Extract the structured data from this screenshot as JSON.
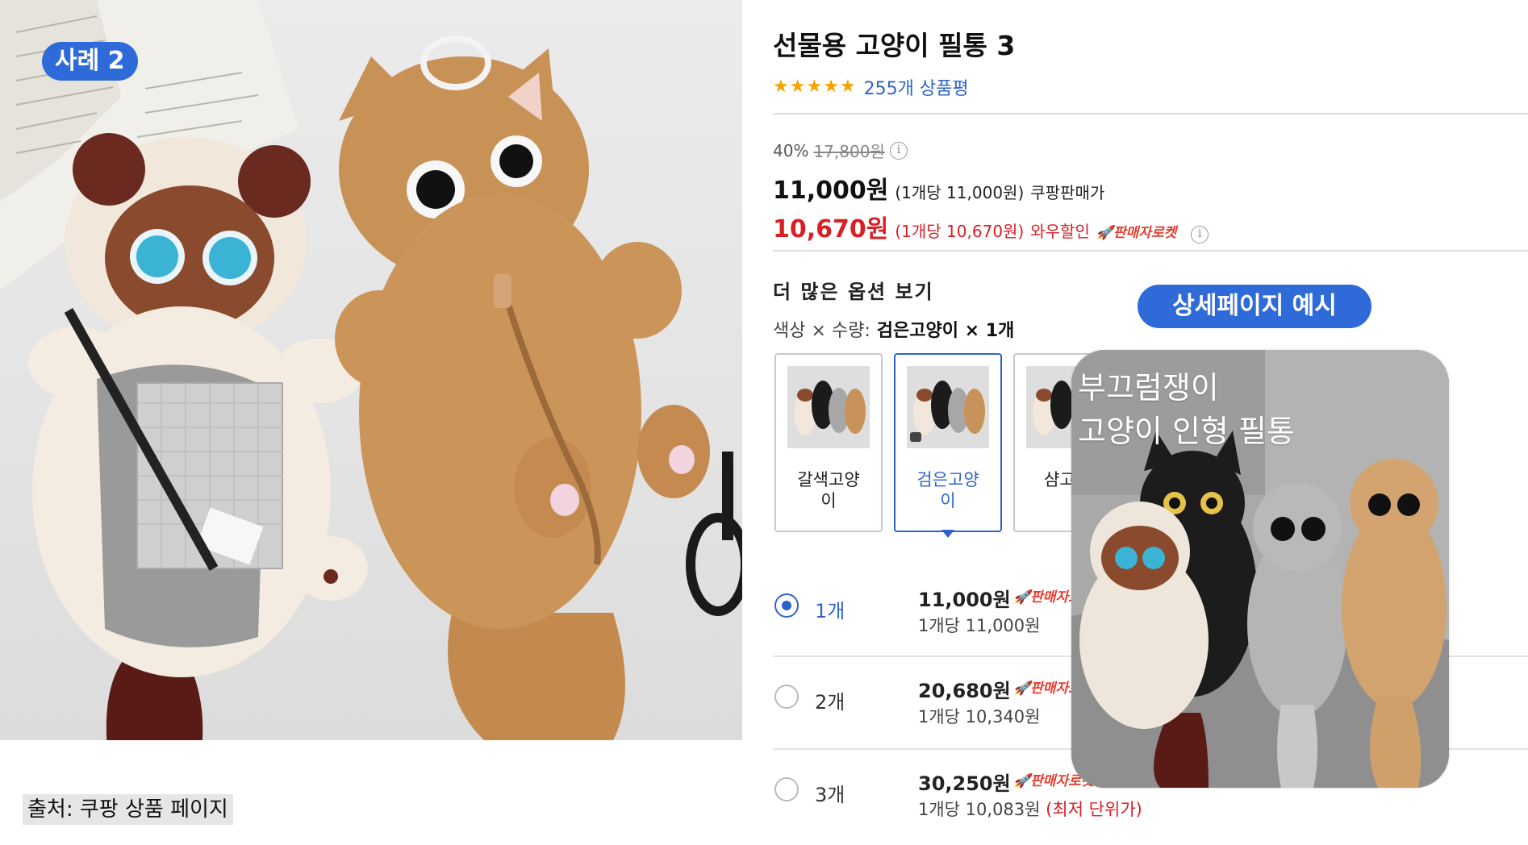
{
  "badge": {
    "label": "사례 2"
  },
  "source": {
    "label": "출처: 쿠팡 상품 페이지"
  },
  "product": {
    "title": "선물용 고양이 필통 3",
    "rating_stars": 5,
    "review_link": "255개 상품평",
    "discount": {
      "percent": "40%",
      "original_price": "17,800원"
    },
    "price": {
      "amount": "11,000원",
      "unit_note": "(1개당 11,000원)",
      "type": "쿠팡판매가"
    },
    "wow_price": {
      "amount": "10,670원",
      "unit_note": "(1개당 10,670원)",
      "type": "와우할인",
      "badge": "판매자로켓"
    }
  },
  "options": {
    "heading": "더 많은 옵션 보기",
    "summary_prefix": "색상 × 수량:",
    "summary_value": "검은고양이 × 1개",
    "swatches": [
      {
        "label": "갈색고양\n이",
        "selected": false
      },
      {
        "label": "검은고양\n이",
        "selected": true
      },
      {
        "label": "샴고양",
        "selected": false
      }
    ],
    "quantities": [
      {
        "qty": "1개",
        "amount": "11,000원",
        "unit": "1개당 11,000원",
        "rocket": "판매자로켓",
        "selected": true,
        "lowest": ""
      },
      {
        "qty": "2개",
        "amount": "20,680원",
        "unit": "1개당 10,340원",
        "rocket": "판매자로켓",
        "selected": false,
        "lowest": ""
      },
      {
        "qty": "3개",
        "amount": "30,250원",
        "unit": "1개당 10,083원",
        "rocket": "판매자로켓",
        "selected": false,
        "lowest": "(최저 단위가)"
      }
    ]
  },
  "example": {
    "pill": "상세페이지 예시",
    "caption_line1": "부끄럼쟁이",
    "caption_line2": "고양이 인형 필통"
  },
  "colors": {
    "accent_blue": "#2f6bd8",
    "link_blue": "#2e64c9",
    "sale_red": "#d91f26",
    "star": "#f5a200"
  }
}
